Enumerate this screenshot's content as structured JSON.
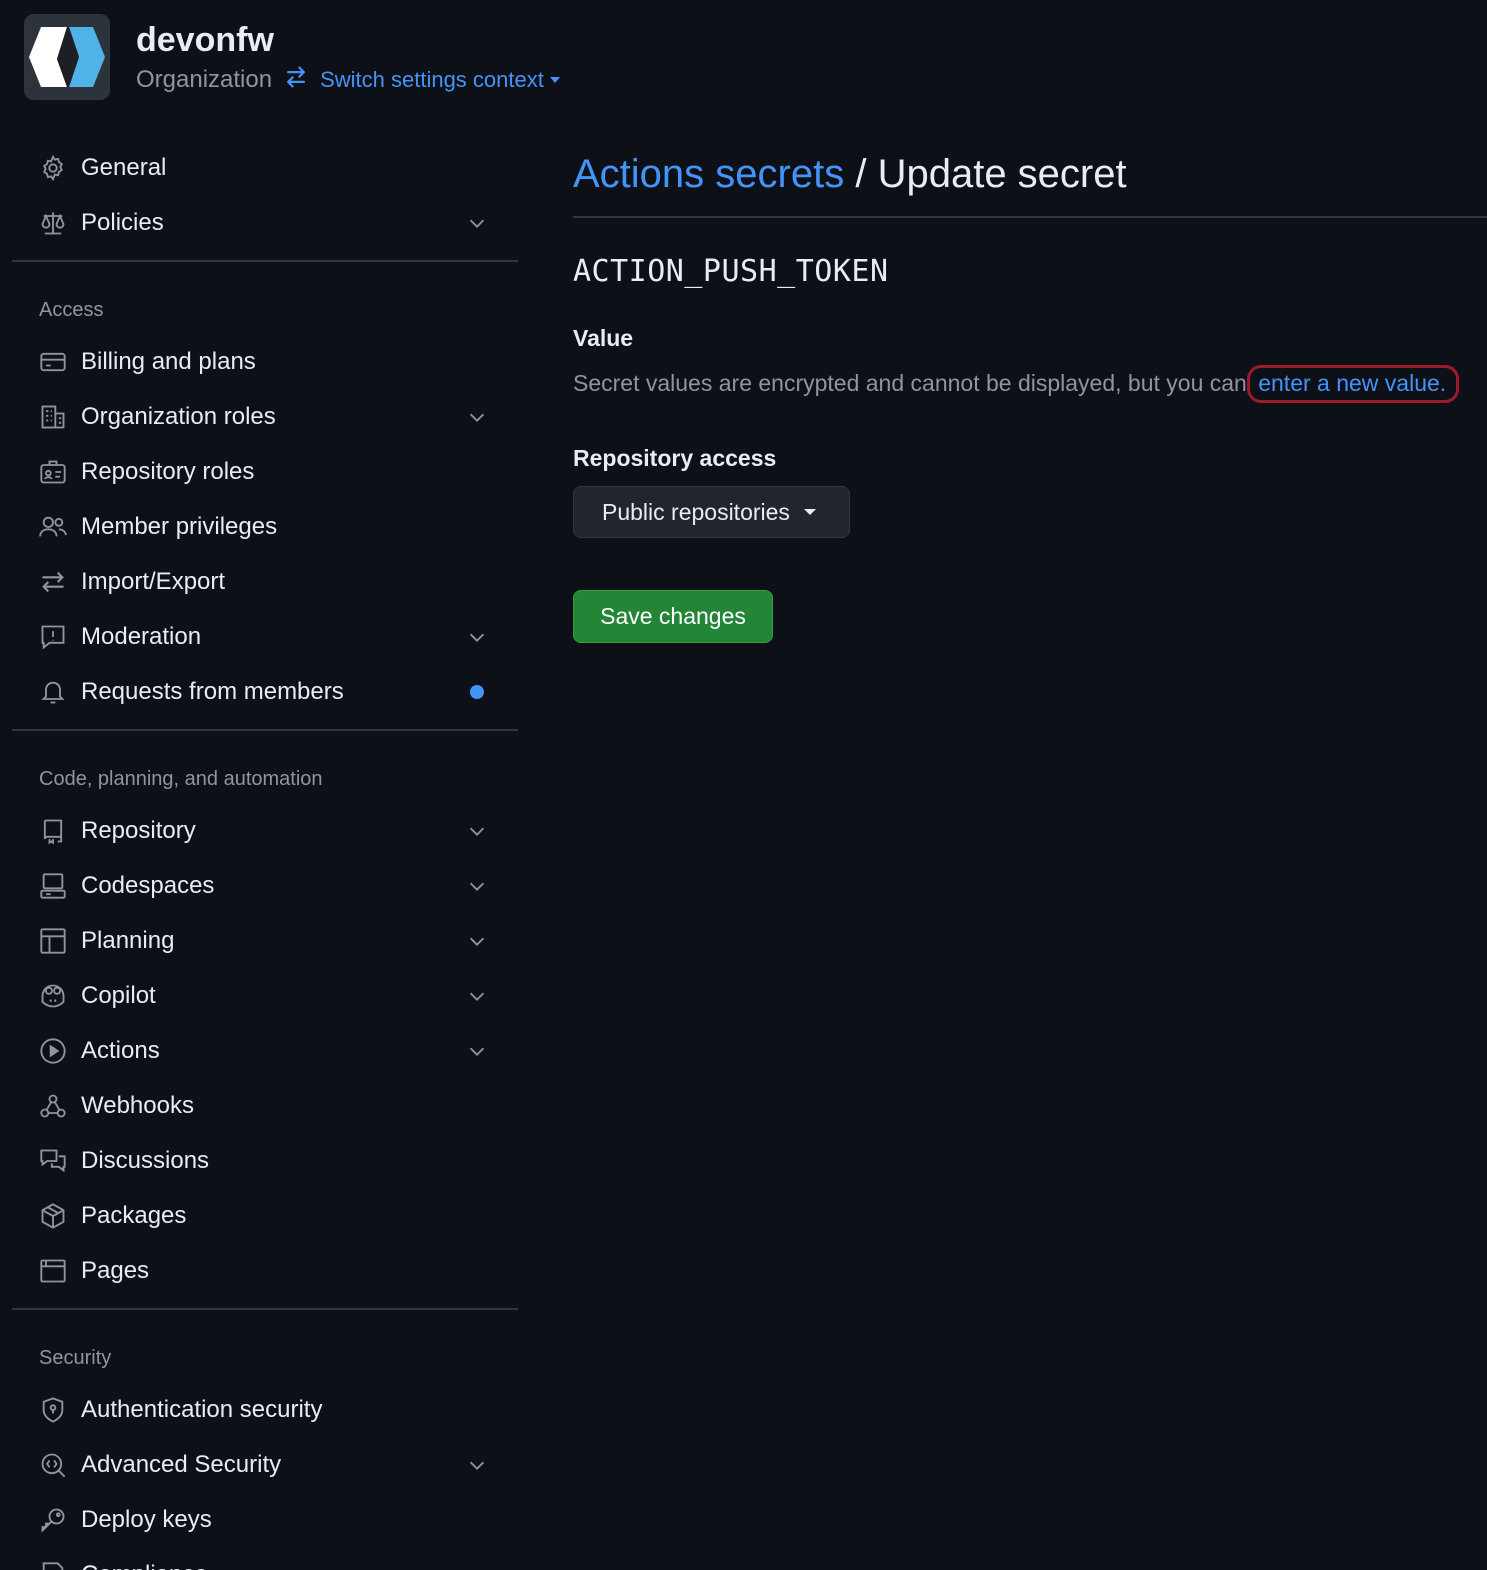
{
  "header": {
    "org_name": "devonfw",
    "org_type": "Organization",
    "switch_label": "Switch settings context"
  },
  "sidebar": {
    "top_items": [
      {
        "label": "General",
        "icon": "gear-icon"
      },
      {
        "label": "Policies",
        "icon": "scale-icon",
        "expandable": true
      }
    ],
    "access_heading": "Access",
    "access_items": [
      {
        "label": "Billing and plans",
        "icon": "credit-card-icon"
      },
      {
        "label": "Organization roles",
        "icon": "organization-icon",
        "expandable": true
      },
      {
        "label": "Repository roles",
        "icon": "id-badge-icon"
      },
      {
        "label": "Member privileges",
        "icon": "people-icon"
      },
      {
        "label": "Import/Export",
        "icon": "arrow-switch-icon"
      },
      {
        "label": "Moderation",
        "icon": "report-icon",
        "expandable": true
      },
      {
        "label": "Requests from members",
        "icon": "bell-icon",
        "badge": "dot"
      }
    ],
    "code_heading": "Code, planning, and automation",
    "code_items": [
      {
        "label": "Repository",
        "icon": "repo-icon",
        "expandable": true
      },
      {
        "label": "Codespaces",
        "icon": "codespaces-icon",
        "expandable": true
      },
      {
        "label": "Planning",
        "icon": "table-icon",
        "expandable": true
      },
      {
        "label": "Copilot",
        "icon": "copilot-icon",
        "expandable": true
      },
      {
        "label": "Actions",
        "icon": "play-icon",
        "expandable": true
      },
      {
        "label": "Webhooks",
        "icon": "webhook-icon"
      },
      {
        "label": "Discussions",
        "icon": "comment-discussion-icon"
      },
      {
        "label": "Packages",
        "icon": "package-icon"
      },
      {
        "label": "Pages",
        "icon": "browser-icon"
      }
    ],
    "security_heading": "Security",
    "security_items": [
      {
        "label": "Authentication security",
        "icon": "shield-lock-icon"
      },
      {
        "label": "Advanced Security",
        "icon": "codescan-icon",
        "expandable": true
      },
      {
        "label": "Deploy keys",
        "icon": "key-icon"
      },
      {
        "label": "Compliance",
        "icon": "checklist-icon"
      }
    ]
  },
  "main": {
    "breadcrumb_link": "Actions secrets",
    "breadcrumb_sep": "/",
    "title": "Update secret",
    "secret_name": "ACTION_PUSH_TOKEN",
    "value_label": "Value",
    "value_desc": "Secret values are encrypted and cannot be displayed, but you can",
    "new_value_link": "enter a new value.",
    "access_label": "Repository access",
    "access_selected": "Public repositories",
    "save_label": "Save changes"
  },
  "colors": {
    "background": "#0d1117",
    "link": "#4493f8",
    "primary_button": "#238636",
    "highlight_outline": "#9a1b2a"
  }
}
